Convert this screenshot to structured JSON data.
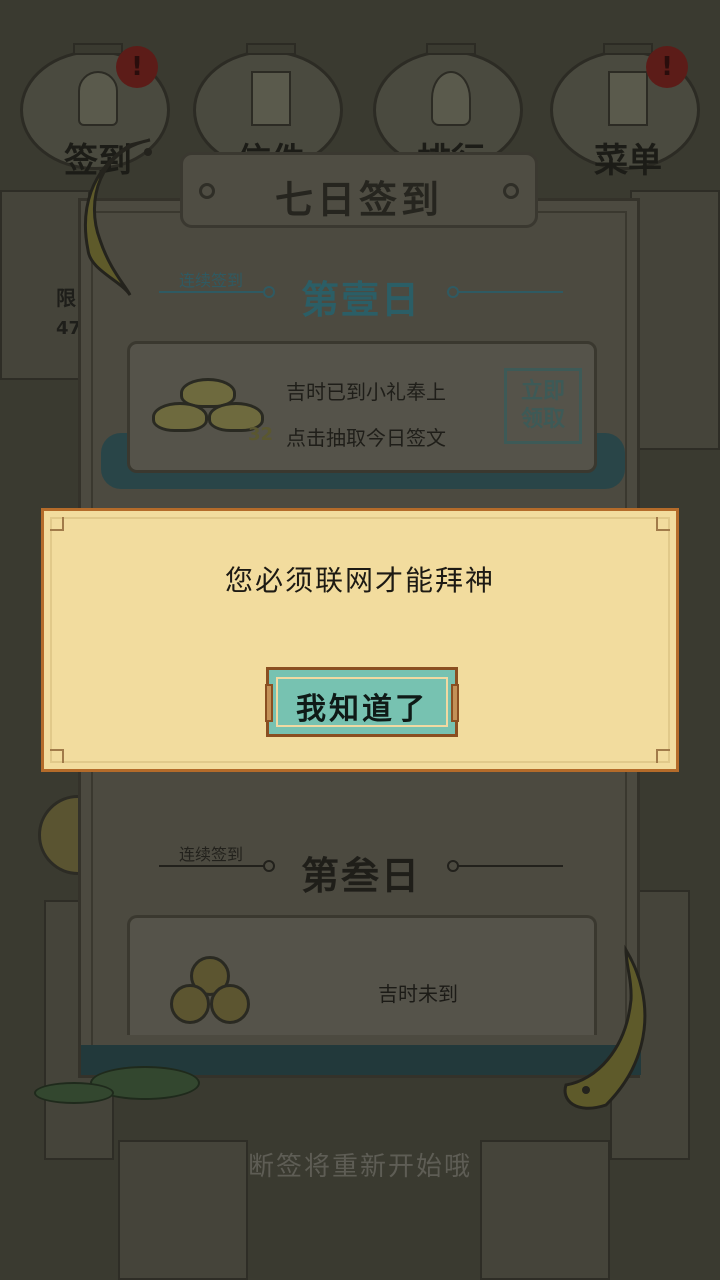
{
  "top_nav": [
    {
      "label": "签到",
      "alert": "!"
    },
    {
      "label": "信件",
      "alert": ""
    },
    {
      "label": "排行",
      "alert": ""
    },
    {
      "label": "菜单",
      "alert": "!"
    }
  ],
  "side": {
    "text1": "限",
    "text2": "47"
  },
  "panel": {
    "title": "七日签到",
    "day1": {
      "sub": "连续签到",
      "title": "第壹日",
      "line1": "吉时已到小礼奉上",
      "line2": "点击抽取今日签文",
      "count": "32",
      "stamp": "立即领取"
    },
    "day3": {
      "sub": "连续签到",
      "title": "第叁日",
      "status": "吉时未到"
    }
  },
  "footer_text": "断签将重新开始哦",
  "dialog": {
    "message": "您必须联网才能拜神",
    "ok_label": "我知道了"
  },
  "colors": {
    "dialog_bg": "#f2dc9e",
    "dialog_border": "#b46b2a",
    "button_bg": "#77c2b1",
    "day1_accent": "#2f6f78"
  }
}
